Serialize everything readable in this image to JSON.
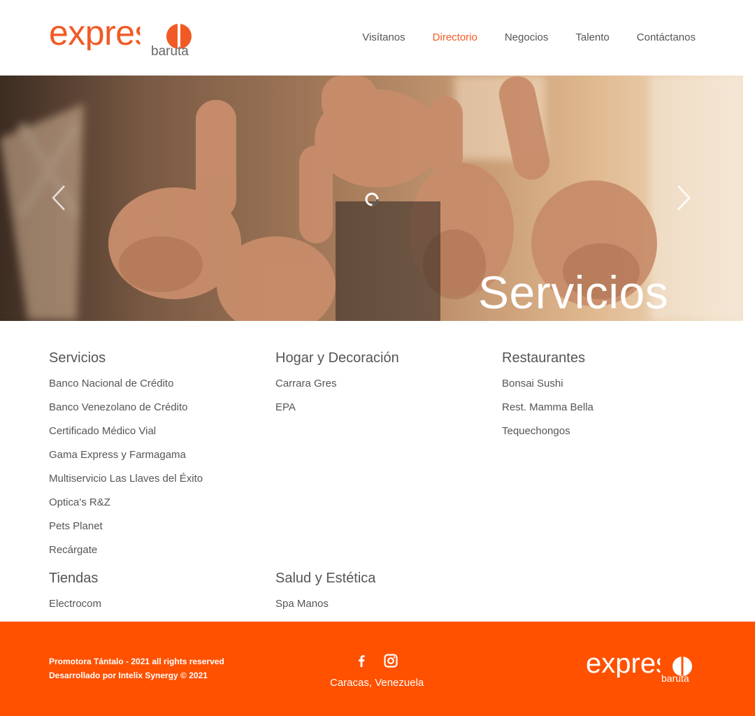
{
  "brand": {
    "logo_word": "expreso",
    "logo_sub": "baruta",
    "accent": "#f15a24",
    "footer_bg": "#ff5100"
  },
  "nav": {
    "items": [
      {
        "label": "Visítanos",
        "active": false
      },
      {
        "label": "Directorio",
        "active": true
      },
      {
        "label": "Negocios",
        "active": false
      },
      {
        "label": "Talento",
        "active": false
      },
      {
        "label": "Contáctanos",
        "active": false
      }
    ]
  },
  "hero": {
    "caption": "Servicios",
    "prev_icon": "chevron-left-icon",
    "next_icon": "chevron-right-icon"
  },
  "directory": {
    "sections": [
      {
        "title": "Servicios",
        "items": [
          "Banco Nacional de Crédito",
          "Banco Venezolano de Crédito",
          "Certificado Médico Vial",
          "Gama Express y Farmagama",
          "Multiservicio Las Llaves del Éxito",
          "Optica's R&Z",
          "Pets Planet",
          "Recárgate"
        ]
      },
      {
        "title": "Hogar y Decoración",
        "items": [
          "Carrara Gres",
          "EPA"
        ]
      },
      {
        "title": "Restaurantes",
        "items": [
          "Bonsai Sushi",
          "Rest. Mamma Bella",
          "Tequechongos"
        ]
      },
      {
        "title": "Tiendas",
        "items": [
          "Electrocom"
        ]
      },
      {
        "title": "Salud y Estética",
        "items": [
          "Spa Manos"
        ]
      }
    ]
  },
  "footer": {
    "legal_line1": "Promotora Tántalo - 2021 all rights reserved",
    "legal_line2": "Desarrollado por Intelix Synergy © 2021",
    "city": "Caracas, Venezuela",
    "social": [
      "facebook-icon",
      "instagram-icon"
    ]
  }
}
